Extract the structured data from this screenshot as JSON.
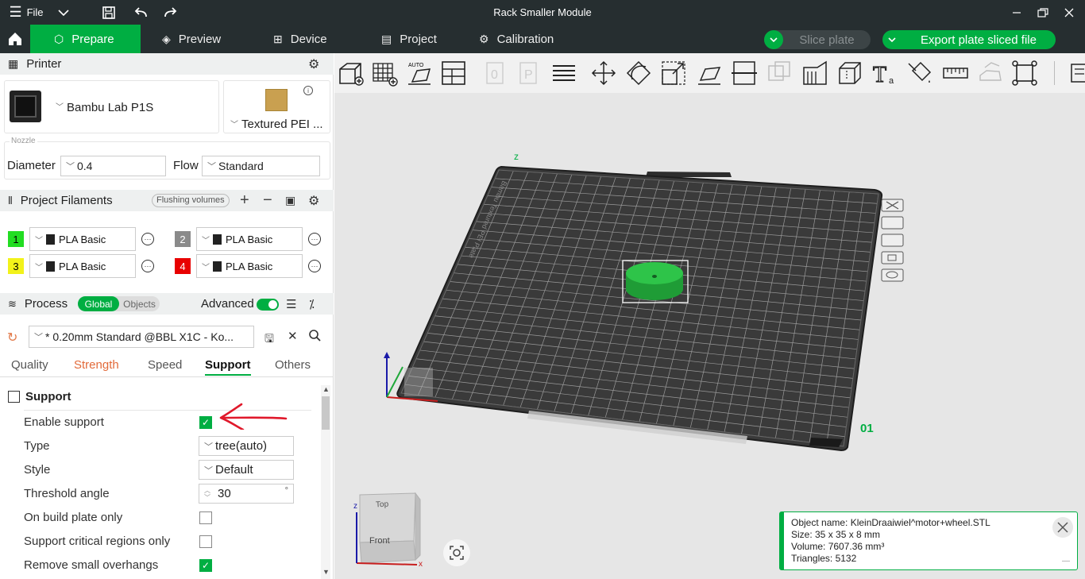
{
  "window": {
    "title": "Rack Smaller Module",
    "file_menu": "File"
  },
  "nav": {
    "tabs": [
      "Prepare",
      "Preview",
      "Device",
      "Project",
      "Calibration"
    ],
    "active": "Prepare",
    "slice_plate": "Slice plate",
    "export": "Export plate sliced file"
  },
  "printer": {
    "header": "Printer",
    "name": "Bambu Lab P1S",
    "plate": "Textured PEI ...",
    "nozzle_label": "Nozzle",
    "diameter_label": "Diameter",
    "diameter": "0.4",
    "flow_label": "Flow",
    "flow": "Standard"
  },
  "filaments": {
    "header": "Project Filaments",
    "flushing": "Flushing volumes",
    "items": [
      {
        "num": "1",
        "name": "PLA Basic",
        "color": "#22dd22"
      },
      {
        "num": "2",
        "name": "PLA Basic",
        "color": "#8a8a8a"
      },
      {
        "num": "3",
        "name": "PLA Basic",
        "color": "#f2f21a"
      },
      {
        "num": "4",
        "name": "PLA Basic",
        "color": "#e80000"
      }
    ]
  },
  "process": {
    "header": "Process",
    "toggle_global": "Global",
    "toggle_objects": "Objects",
    "advanced": "Advanced",
    "preset": "* 0.20mm Standard @BBL X1C - Ko..."
  },
  "tabs": {
    "items": [
      "Quality",
      "Strength",
      "Speed",
      "Support",
      "Others"
    ],
    "active": "Support"
  },
  "support": {
    "section": "Support",
    "rows": [
      {
        "label": "Enable support",
        "kind": "check",
        "checked": true
      },
      {
        "label": "Type",
        "kind": "combo",
        "value": "tree(auto)"
      },
      {
        "label": "Style",
        "kind": "combo",
        "value": "Default"
      },
      {
        "label": "Threshold angle",
        "kind": "spin",
        "value": "30",
        "unit": "°"
      },
      {
        "label": "On build plate only",
        "kind": "check",
        "checked": false
      },
      {
        "label": "Support critical regions only",
        "kind": "check",
        "checked": false
      },
      {
        "label": "Remove small overhangs",
        "kind": "check",
        "checked": true
      }
    ]
  },
  "viewport": {
    "plate_number": "01",
    "plate_label": "Bambu Textured PEI Plate",
    "cube_top": "Top",
    "cube_front": "Front",
    "axis_x": "x",
    "axis_z": "z"
  },
  "object_info": {
    "name": "Object name: KleinDraaiwiel^motor+wheel.STL",
    "size": "Size: 35 x 35 x 8 mm",
    "volume": "Volume: 7607.36 mm³",
    "triangles": "Triangles: 5132"
  },
  "colors": {
    "accent": "#00ae42",
    "titlebar": "#262e30",
    "annotation": "#e0192b"
  }
}
